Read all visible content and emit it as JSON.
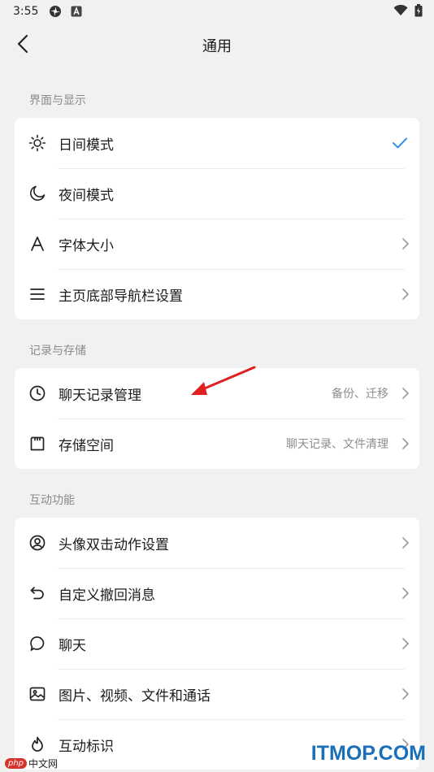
{
  "status_bar": {
    "time": "3:55",
    "left_icons": [
      "pinwheel-icon",
      "letter-a-icon"
    ],
    "right_icons": [
      "wifi-icon",
      "battery-icon"
    ]
  },
  "header": {
    "title": "通用"
  },
  "sections": [
    {
      "header": "界面与显示",
      "items": [
        {
          "label": "日间模式",
          "icon": "sun-icon",
          "checked": true
        },
        {
          "label": "夜间模式",
          "icon": "moon-icon"
        },
        {
          "label": "字体大小",
          "icon": "font-a-icon"
        },
        {
          "label": "主页底部导航栏设置",
          "icon": "menu-lines-icon"
        }
      ]
    },
    {
      "header": "记录与存储",
      "items": [
        {
          "label": "聊天记录管理",
          "sub": "备份、迁移",
          "icon": "clock-icon"
        },
        {
          "label": "存储空间",
          "sub": "聊天记录、文件清理",
          "icon": "storage-card-icon"
        }
      ]
    },
    {
      "header": "互动功能",
      "items": [
        {
          "label": "头像双击动作设置",
          "icon": "avatar-circle-icon"
        },
        {
          "label": "自定义撤回消息",
          "icon": "undo-arrow-icon"
        },
        {
          "label": "聊天",
          "icon": "chat-bubble-icon"
        },
        {
          "label": "图片、视频、文件和通话",
          "icon": "image-icon"
        },
        {
          "label": "互动标识",
          "icon": "flame-icon"
        }
      ]
    }
  ],
  "watermarks": {
    "itmop": "ITMOP.COM",
    "php_badge": "php",
    "php_text": "中文网"
  },
  "colors": {
    "background": "#f1f1f1",
    "card": "#ffffff",
    "accent_check": "#3a8ee6",
    "annotation_arrow": "#e02020"
  }
}
